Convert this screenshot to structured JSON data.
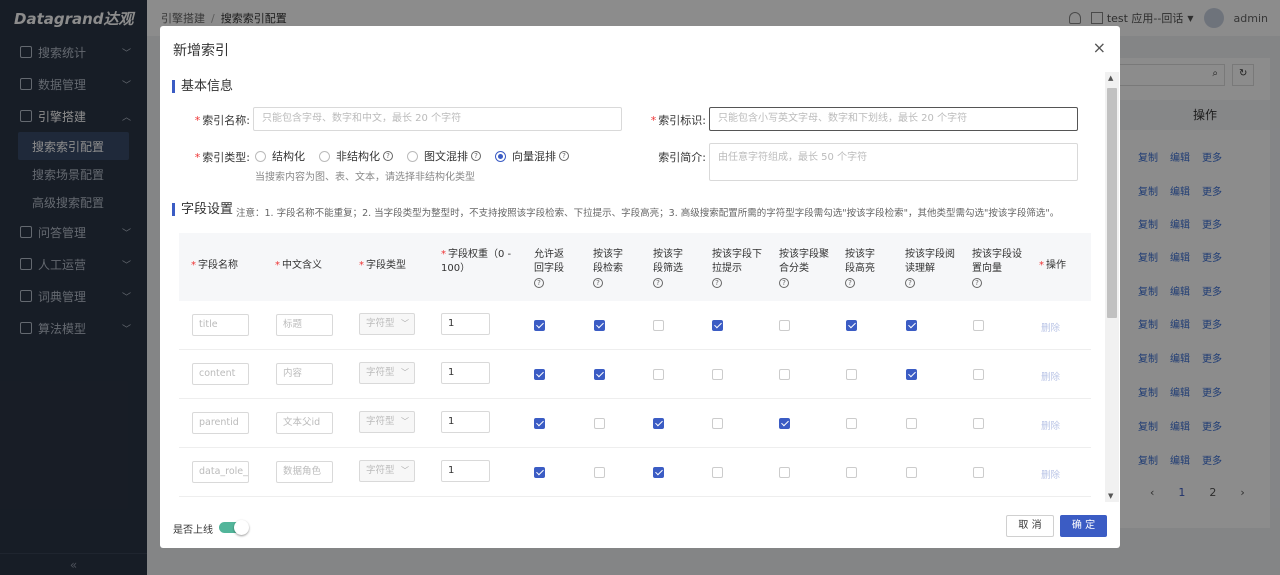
{
  "app": {
    "logo": "Datagrand达观",
    "breadcrumb": [
      "引擎搭建",
      "搜索索引配置"
    ],
    "app_selector": "test 应用--回话",
    "user": "admin"
  },
  "sidebar": {
    "items": [
      {
        "label": "搜索统计",
        "icon": "chart-icon"
      },
      {
        "label": "数据管理",
        "icon": "database-icon"
      },
      {
        "label": "引擎搭建",
        "icon": "build-icon"
      },
      {
        "label": "问答管理",
        "icon": "qa-icon"
      },
      {
        "label": "人工运营",
        "icon": "operate-icon"
      },
      {
        "label": "词典管理",
        "icon": "dictionary-icon"
      },
      {
        "label": "算法模型",
        "icon": "model-icon"
      }
    ],
    "sub_items": [
      "搜索索引配置",
      "搜索场景配置",
      "高级搜索配置"
    ],
    "collapse": "«"
  },
  "background": {
    "ops_header": "操作",
    "row_actions": [
      "复制",
      "编辑",
      "更多"
    ],
    "pager": [
      "‹",
      "1",
      "2",
      "›"
    ]
  },
  "modal": {
    "title": "新增索引",
    "close": "×",
    "basic_title": "基本信息",
    "name_label": "索引名称:",
    "name_placeholder": "只能包含字母、数字和中文，最长 20 个字符",
    "id_label": "索引标识:",
    "id_placeholder": "只能包含小写英文字母、数字和下划线，最长 20 个字符",
    "type_label": "索引类型:",
    "types": [
      "结构化",
      "非结构化",
      "图文混排",
      "向量混排"
    ],
    "type_hint": "当搜索内容为图、表、文本，请选择非结构化类型",
    "desc_label": "索引简介:",
    "desc_placeholder": "由任意字符组成，最长 50 个字符",
    "field_title": "字段设置",
    "field_note": "注意：1. 字段名称不能重复；2. 当字段类型为整型时，不支持按照该字段检索、下拉提示、字段高亮；3. 高级搜索配置所需的字符型字段需勾选\"按该字段检索\"，其他类型需勾选\"按该字段筛选\"。",
    "columns": [
      "字段名称",
      "中文含义",
      "字段类型",
      "字段权重（0 - 100）",
      "允许返回字段",
      "按该字段检索",
      "按该字段筛选",
      "按该字段下拉提示",
      "按该字段聚合分类",
      "按该字段高亮",
      "按该字段阅读理解",
      "按该字段设置向量",
      "操作"
    ],
    "rows": [
      {
        "name": "title",
        "meaning": "标题",
        "type": "字符型",
        "weight": "1",
        "checks": [
          true,
          true,
          false,
          true,
          false,
          true,
          true,
          false
        ],
        "action": "删除"
      },
      {
        "name": "content",
        "meaning": "内容",
        "type": "字符型",
        "weight": "1",
        "checks": [
          true,
          true,
          false,
          false,
          false,
          false,
          true,
          false
        ],
        "action": "删除"
      },
      {
        "name": "parentid",
        "meaning": "文本父id",
        "type": "字符型",
        "weight": "1",
        "checks": [
          true,
          false,
          true,
          false,
          true,
          false,
          false,
          false
        ],
        "action": "删除"
      },
      {
        "name": "data_role_i",
        "meaning": "数据角色",
        "type": "字符型",
        "weight": "1",
        "checks": [
          true,
          false,
          true,
          false,
          false,
          false,
          false,
          false
        ],
        "action": "删除"
      }
    ],
    "online_label": "是否上线",
    "cancel": "取 消",
    "confirm": "确 定"
  }
}
